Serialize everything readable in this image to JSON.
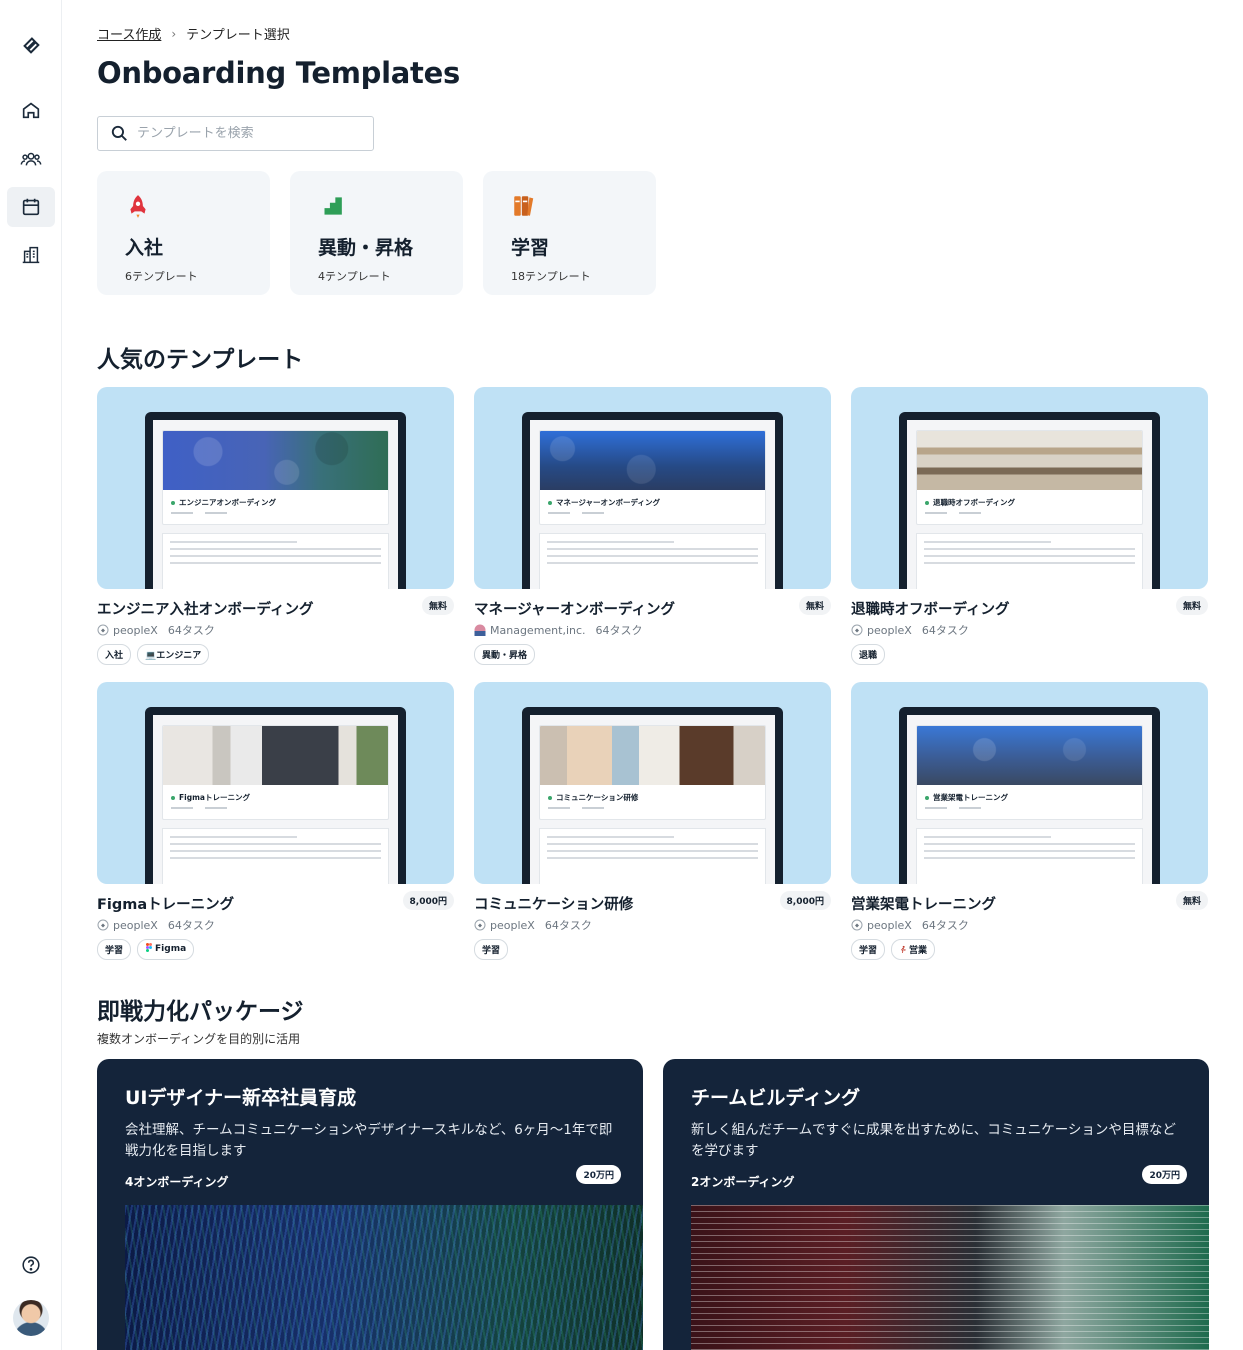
{
  "breadcrumb": {
    "link": "コース作成",
    "current": "テンプレート選択"
  },
  "page": {
    "title": "Onboarding Templates"
  },
  "search": {
    "placeholder": "テンプレートを検索"
  },
  "categories": [
    {
      "name": "入社",
      "count": "6テンプレート",
      "icon": "rocket-icon",
      "color": "#e0343e"
    },
    {
      "name": "異動・昇格",
      "count": "4テンプレート",
      "icon": "stairs-icon",
      "color": "#2e9e57"
    },
    {
      "name": "学習",
      "count": "18テンプレート",
      "icon": "books-icon",
      "color": "#e37a2a"
    }
  ],
  "popular": {
    "title": "人気のテンプレート",
    "items": [
      {
        "screen_title": "エンジニアオンボーディング",
        "name": "エンジニア入社オンボーディング",
        "price": "無料",
        "org": "peopleX",
        "tasks": "64タスク",
        "tags": [
          "入社",
          "💻エンジニア"
        ]
      },
      {
        "screen_title": "マネージャーオンボーディング",
        "name": "マネージャーオンボーディング",
        "price": "無料",
        "org": "Management,inc.",
        "tasks": "64タスク",
        "tags": [
          "異動・昇格"
        ]
      },
      {
        "screen_title": "退職時オフボーディング",
        "name": "退職時オフボーディング",
        "price": "無料",
        "org": "peopleX",
        "tasks": "64タスク",
        "tags": [
          "退職"
        ]
      },
      {
        "screen_title": "Figmaトレーニング",
        "name": "Figmaトレーニング",
        "price": "8,000円",
        "org": "peopleX",
        "tasks": "64タスク",
        "tags": [
          "学習",
          "Figma"
        ]
      },
      {
        "screen_title": "コミュニケーション研修",
        "name": "コミュニケーション研修",
        "price": "8,000円",
        "org": "peopleX",
        "tasks": "64タスク",
        "tags": [
          "学習"
        ]
      },
      {
        "screen_title": "営業架電トレーニング",
        "name": "営業架電トレーニング",
        "price": "無料",
        "org": "peopleX",
        "tasks": "64タスク",
        "tags": [
          "学習",
          "営業"
        ]
      }
    ]
  },
  "packages": {
    "title": "即戦力化パッケージ",
    "subtitle": "複数オンボーディングを目的別に活用",
    "items": [
      {
        "title": "UIデザイナー新卒社員育成",
        "desc": "会社理解、チームコミュニケーションやデザイナースキルなど、6ヶ月〜1年で即戦力化を目指します",
        "count": "4オンボーディング",
        "price": "20万円"
      },
      {
        "title": "チームビルディング",
        "desc": "新しく組んだチームですぐに成果を出すために、コミュニケーションや目標などを学びます",
        "count": "2オンボーディング",
        "price": "20万円"
      }
    ]
  }
}
